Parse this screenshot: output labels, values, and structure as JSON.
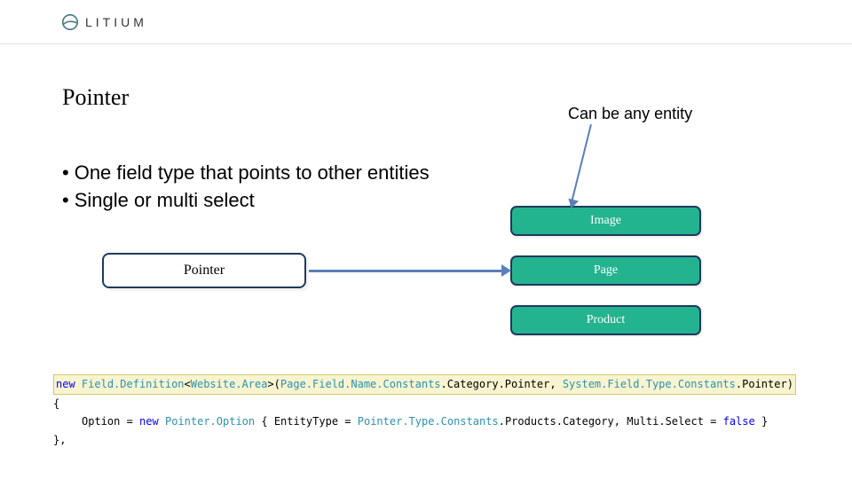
{
  "brand": {
    "name": "LITIUM"
  },
  "title": "Pointer",
  "annotation": "Can be any entity",
  "bullets": [
    "One field type that points to other entities",
    "Single or multi select"
  ],
  "pointer_box_label": "Pointer",
  "entities": {
    "image": "Image",
    "page": "Page",
    "product": "Product"
  },
  "code": {
    "kw_new": "new",
    "kw_false": "false",
    "cls_fd": "Field.Definition",
    "cls_wa": "Website.Area",
    "cls_pfnc": "Page.Field.Name.Constants",
    "prop_cp": "Category.Pointer",
    "cls_sftc": "System.Field.Type.Constants",
    "prop_ptr": "Pointer",
    "prop_option": "Option",
    "cls_po": "Pointer.Option",
    "prop_et": "EntityType",
    "cls_ptc": "Pointer.Type.Constants",
    "prop_pc": "Products.Category",
    "prop_ms": "Multi.Select",
    "brace_open": "{",
    "brace_close": "},"
  }
}
